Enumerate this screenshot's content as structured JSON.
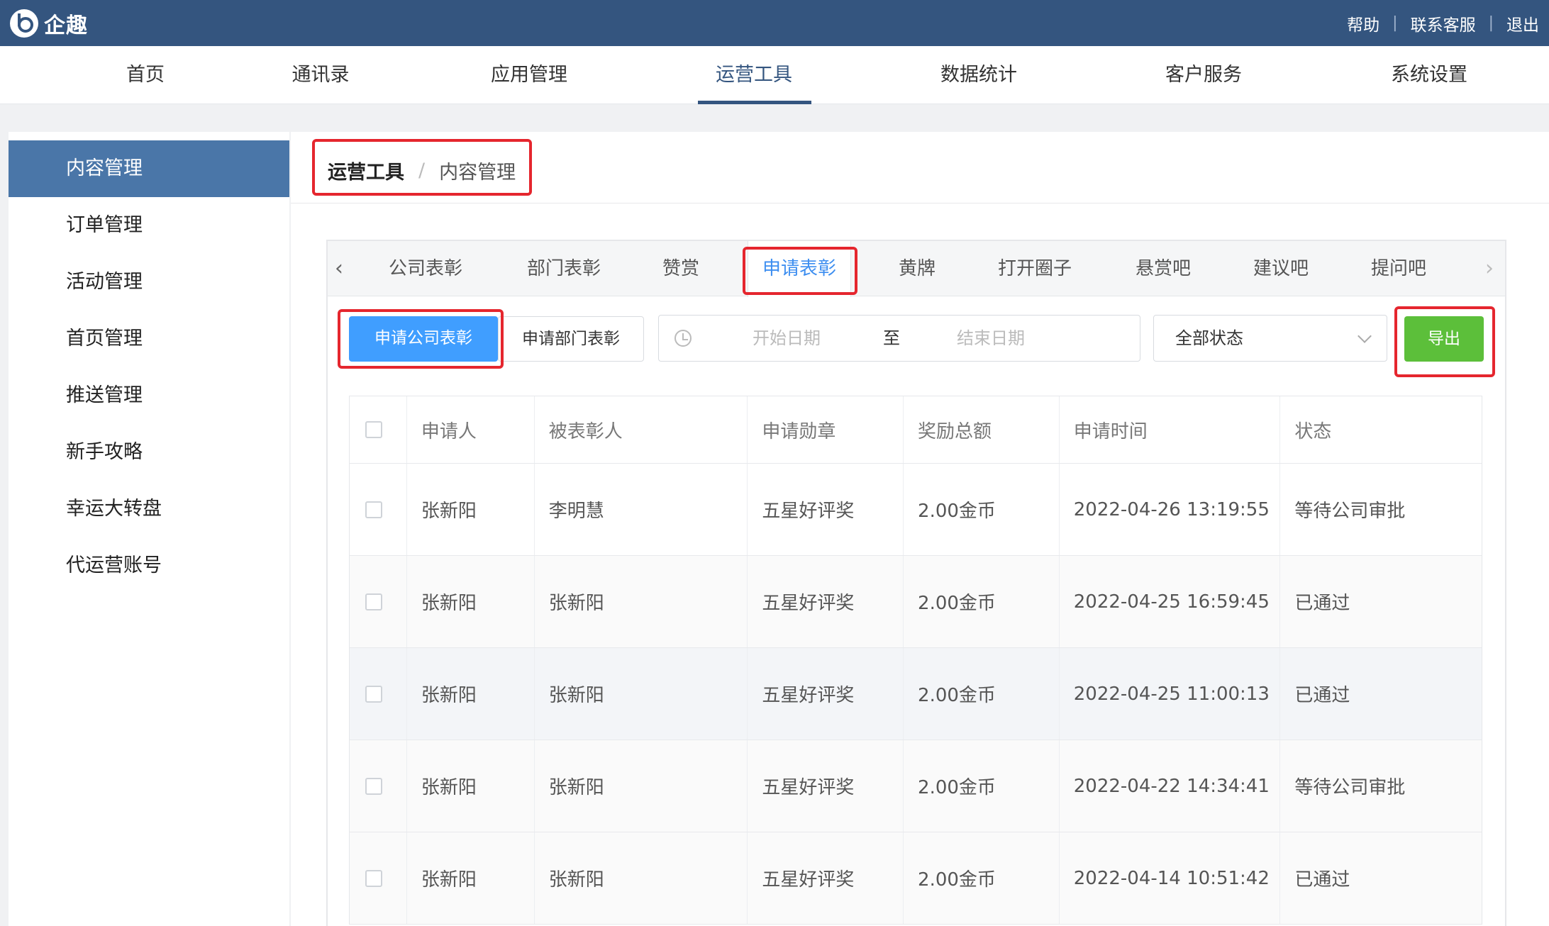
{
  "brand": {
    "name": "企趣"
  },
  "top_links": [
    "帮助",
    "联系客服",
    "退出"
  ],
  "main_nav": {
    "items": [
      "首页",
      "通讯录",
      "应用管理",
      "运营工具",
      "数据统计",
      "客户服务",
      "系统设置"
    ],
    "active": "运营工具"
  },
  "sidebar": {
    "items": [
      "内容管理",
      "订单管理",
      "活动管理",
      "首页管理",
      "推送管理",
      "新手攻略",
      "幸运大转盘",
      "代运营账号"
    ],
    "active": "内容管理"
  },
  "breadcrumb": {
    "parent": "运营工具",
    "separator": "/",
    "current": "内容管理"
  },
  "tabs": {
    "items": [
      "公司表彰",
      "部门表彰",
      "赞赏",
      "申请表彰",
      "黄牌",
      "打开圈子",
      "悬赏吧",
      "建议吧",
      "提问吧"
    ],
    "active": "申请表彰",
    "prev_icon": "chevron-left-icon",
    "next_icon": "chevron-right-icon"
  },
  "filters": {
    "type_buttons": [
      "申请公司表彰",
      "申请部门表彰"
    ],
    "active_type": "申请公司表彰",
    "date_start_placeholder": "开始日期",
    "date_separator": "至",
    "date_end_placeholder": "结束日期",
    "status_value": "全部状态",
    "export_label": "导出"
  },
  "table": {
    "columns": [
      "申请人",
      "被表彰人",
      "申请勋章",
      "奖励总额",
      "申请时间",
      "状态"
    ],
    "rows": [
      [
        "张新阳",
        "李明慧",
        "五星好评奖",
        "2.00金币",
        "2022-04-26 13:19:55",
        "等待公司审批"
      ],
      [
        "张新阳",
        "张新阳",
        "五星好评奖",
        "2.00金币",
        "2022-04-25 16:59:45",
        "已通过"
      ],
      [
        "张新阳",
        "张新阳",
        "五星好评奖",
        "2.00金币",
        "2022-04-25 11:00:13",
        "已通过"
      ],
      [
        "张新阳",
        "张新阳",
        "五星好评奖",
        "2.00金币",
        "2022-04-22 14:34:41",
        "等待公司审批"
      ],
      [
        "张新阳",
        "张新阳",
        "五星好评奖",
        "2.00金币",
        "2022-04-14 10:51:42",
        "已通过"
      ]
    ]
  },
  "colors": {
    "topbar": "#34557f",
    "sidebar_active": "#4a76a8",
    "primary": "#409eff",
    "export": "#5cbf3a",
    "highlight": "#e5262e"
  }
}
